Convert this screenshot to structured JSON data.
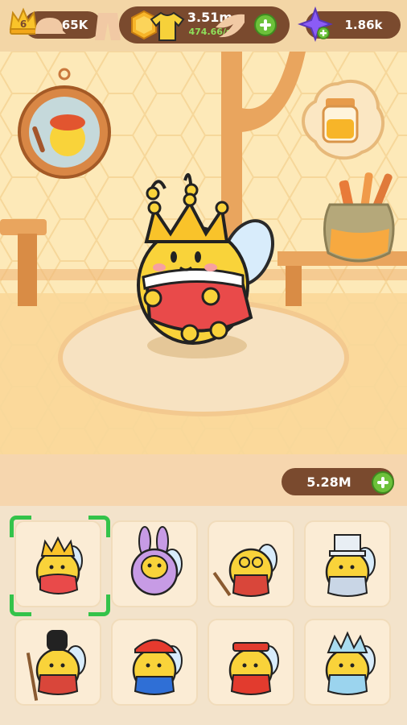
{
  "topbar": {
    "level": "6",
    "trophies": "4.65K",
    "gold": "3.51m",
    "gold_rate": "474.66/s",
    "gems": "1.86k"
  },
  "scene": {
    "character": "bee-king",
    "wall_items": [
      "portrait-frame-icon",
      "honey-jar-sign-icon",
      "brush-pot-icon"
    ]
  },
  "toolbar": {
    "categories": [
      "hat-icon",
      "pants-icon",
      "shirt-icon",
      "wings-icon"
    ],
    "selected_category": "shirt-icon",
    "coins": "5.28M"
  },
  "costumes": [
    {
      "name": "king",
      "selected": true
    },
    {
      "name": "bunny"
    },
    {
      "name": "professor"
    },
    {
      "name": "top-hat"
    },
    {
      "name": "guard"
    },
    {
      "name": "plumber"
    },
    {
      "name": "festive"
    },
    {
      "name": "frost"
    }
  ],
  "colors": {
    "accent_green": "#6cc13a",
    "pill_brown": "#7a4a2e",
    "gold_rate": "#8fe05a",
    "bee_yellow": "#f9d33a",
    "selection": "#34c34a"
  }
}
